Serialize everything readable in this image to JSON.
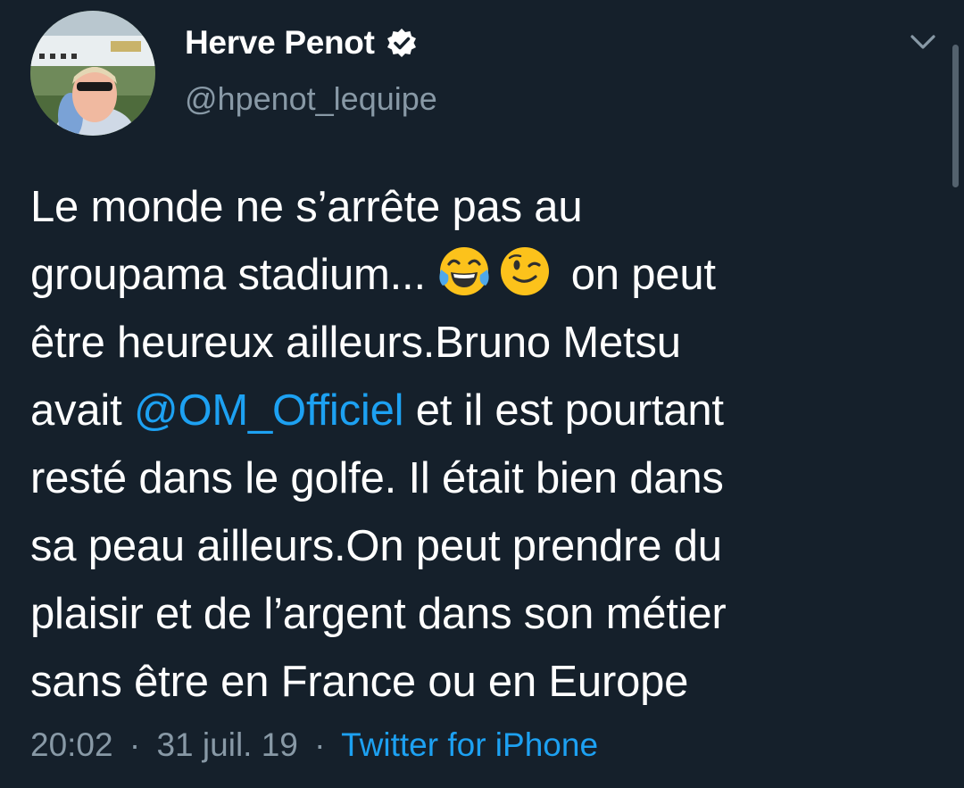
{
  "author": {
    "display_name": "Herve Penot",
    "handle": "@hpenot_lequipe",
    "verified": true
  },
  "tweet": {
    "line1": "Le monde ne s’arrête pas au",
    "line2_text": "groupama stadium...",
    "line2_emojis": [
      "face-with-tears-of-joy",
      "winking-face"
    ],
    "line2_end": "on peut",
    "line3": "être heureux ailleurs.Bruno Metsu",
    "line4_start": "avait",
    "mention": "@OM_Officiel",
    "line4_end": "et il est pourtant",
    "line5": "resté dans le golfe. Il était bien dans",
    "line6": "sa peau ailleurs.On peut prendre du",
    "line7": "plaisir et de l’argent dans son métier",
    "line8": "sans être en France ou en Europe"
  },
  "meta": {
    "time": "20:02",
    "date": "31 juil. 19",
    "separator": "·",
    "source": "Twitter for iPhone"
  },
  "colors": {
    "background": "#15202b",
    "text": "#ffffff",
    "secondary": "#8899a6",
    "accent": "#1da1f2"
  },
  "icons": {
    "verified": "verified-badge-icon",
    "menu": "chevron-down-icon"
  }
}
